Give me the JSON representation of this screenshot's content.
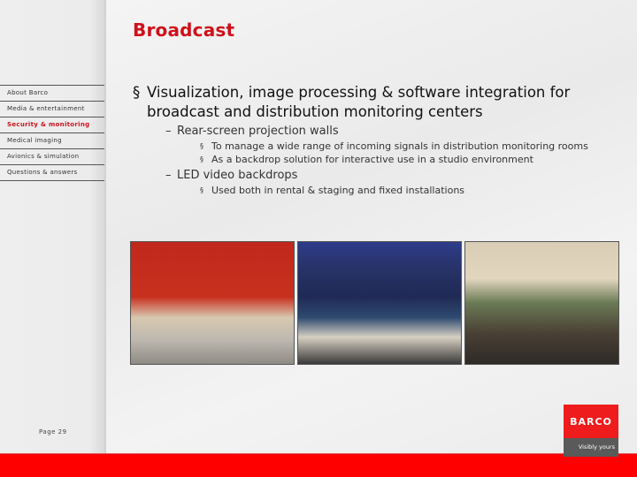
{
  "slide": {
    "title": "Broadcast",
    "page_label": "Page 29"
  },
  "nav": {
    "items": [
      {
        "label": "About Barco",
        "active": false
      },
      {
        "label": "Media & entertainment",
        "active": false
      },
      {
        "label": "Security & monitoring",
        "active": true
      },
      {
        "label": "Medical imaging",
        "active": false
      },
      {
        "label": "Avionics & simulation",
        "active": false
      },
      {
        "label": "Questions & answers",
        "active": false
      }
    ]
  },
  "content": {
    "bullet": "§",
    "main_point": "Visualization, image processing & software integration for broadcast and distribution monitoring centers",
    "sub_points": [
      {
        "dash": "–",
        "label": "Rear-screen projection walls",
        "details": [
          "To manage a wide range of incoming signals in distribution monitoring rooms",
          "As a backdrop solution for interactive use in a studio environment"
        ]
      },
      {
        "dash": "–",
        "label": "LED video backdrops",
        "details": [
          "Used both in rental & staging and fixed installations"
        ]
      }
    ]
  },
  "photos": [
    {
      "subject": "news-studio-anchors"
    },
    {
      "subject": "led-video-wall-presenter"
    },
    {
      "subject": "monitoring-control-room"
    }
  ],
  "logo": {
    "brand": "BARCO",
    "tagline": "Visibly yours"
  },
  "colors": {
    "accent": "#d0101a",
    "footer_bar": "#ff0000",
    "logo_red": "#ee1c1c",
    "logo_gray": "#5a5a5a"
  }
}
